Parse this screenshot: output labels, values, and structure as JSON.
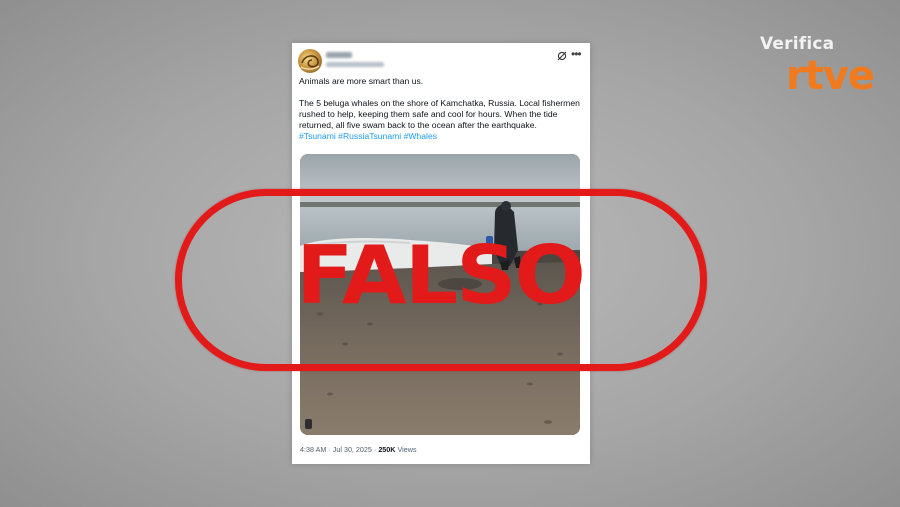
{
  "brand": {
    "line1": "Verifica",
    "line2": "rtve",
    "accent_color": "#f07a1d"
  },
  "post": {
    "author_name": "",
    "author_handle": "",
    "line1": "Animals are more smart than us.",
    "body": "The 5 beluga whales on the shore of Kamchatka, Russia. Local fishermen rushed to help, keeping them safe and cool for hours. When the tide returned, all five swam back to the ocean after the earthquake.",
    "hashtags": [
      "#Tsunami",
      "#RussiaTsunami",
      "#Whales"
    ],
    "hashtag_color": "#1d9bf0",
    "timestamp": "4:38 AM · Jul 30, 2025 · ",
    "views_count": "250K",
    "views_label": " Views",
    "icons": [
      "grok-icon",
      "more-icon",
      "video-icon"
    ]
  },
  "stamp": {
    "word": "FALSO",
    "color": "#e21a1a"
  }
}
